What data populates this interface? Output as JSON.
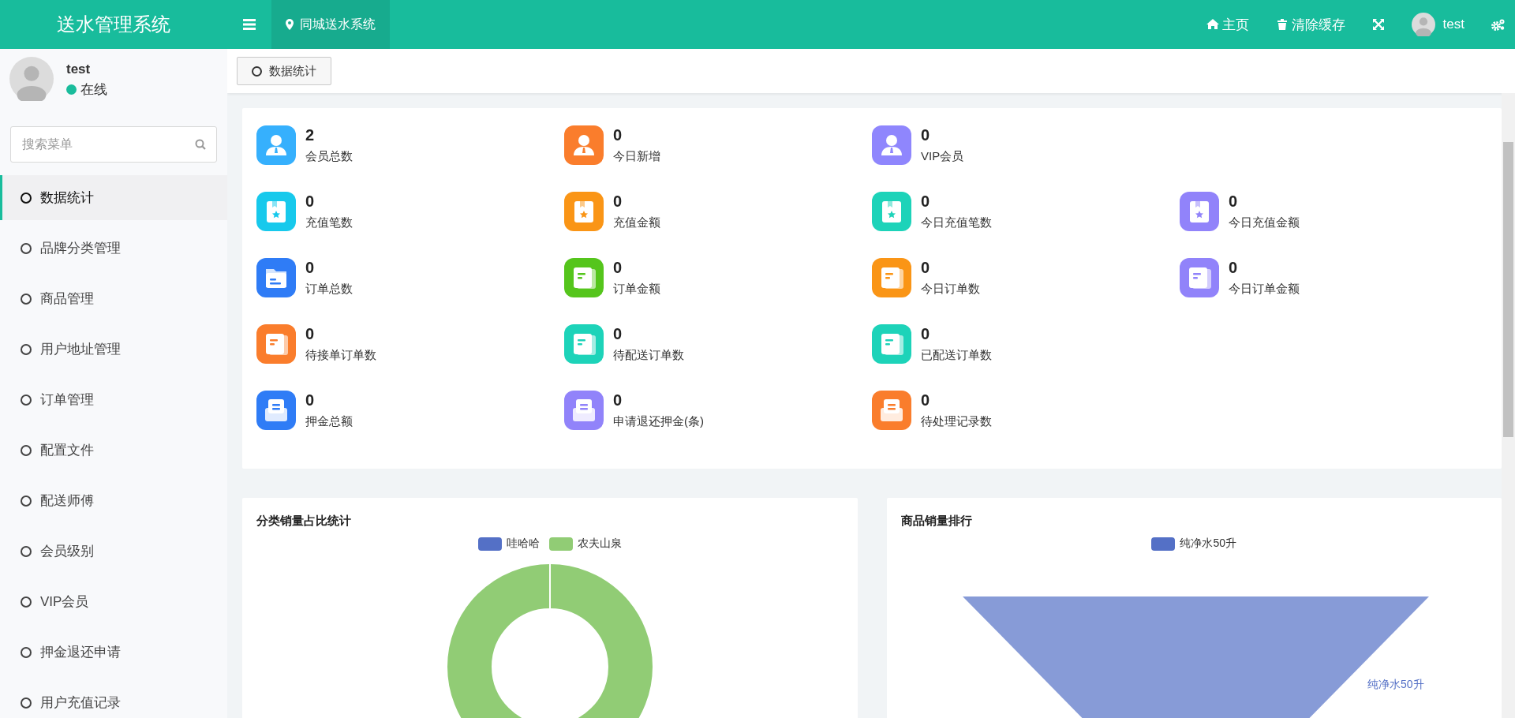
{
  "header": {
    "logo": "送水管理系统",
    "location_tab": "同城送水系统",
    "links": [
      {
        "kind": "home",
        "label": "主页"
      },
      {
        "kind": "trash",
        "label": "清除缓存"
      }
    ],
    "user": "test"
  },
  "sidebar": {
    "user": {
      "name": "test",
      "status": "在线",
      "online": true
    },
    "search": {
      "placeholder": "搜索菜单"
    },
    "items": [
      {
        "label": "数据统计",
        "selected": true
      },
      {
        "label": "品牌分类管理",
        "selected": false
      },
      {
        "label": "商品管理",
        "selected": false
      },
      {
        "label": "用户地址管理",
        "selected": false
      },
      {
        "label": "订单管理",
        "selected": false
      },
      {
        "label": "配置文件",
        "selected": false
      },
      {
        "label": "配送师傅",
        "selected": false
      },
      {
        "label": "会员级别",
        "selected": false
      },
      {
        "label": "VIP会员",
        "selected": false
      },
      {
        "label": "押金退还申请",
        "selected": false
      },
      {
        "label": "用户充值记录",
        "selected": false
      }
    ]
  },
  "tabs": [
    {
      "label": "数据统计"
    }
  ],
  "stats": [
    [
      {
        "kind": "user",
        "color": "#36b0fd",
        "value": "2",
        "label": "会员总数"
      },
      {
        "kind": "user",
        "color": "#fa7d2c",
        "value": "0",
        "label": "今日新增"
      },
      {
        "kind": "user",
        "color": "#8f86fd",
        "value": "0",
        "label": "VIP会员"
      }
    ],
    [
      {
        "kind": "card",
        "color": "#17c9ec",
        "value": "0",
        "label": "充值笔数"
      },
      {
        "kind": "card",
        "color": "#fa9516",
        "value": "0",
        "label": "充值金额"
      },
      {
        "kind": "card",
        "color": "#1dd3b9",
        "value": "0",
        "label": "今日充值笔数"
      },
      {
        "kind": "card",
        "color": "#9183fa",
        "value": "0",
        "label": "今日充值金额"
      }
    ],
    [
      {
        "kind": "folder",
        "color": "#2f7cf6",
        "value": "0",
        "label": "订单总数"
      },
      {
        "kind": "doc",
        "color": "#55c51c",
        "value": "0",
        "label": "订单金额"
      },
      {
        "kind": "doc",
        "color": "#fa9516",
        "value": "0",
        "label": "今日订单数"
      },
      {
        "kind": "doc",
        "color": "#9183fa",
        "value": "0",
        "label": "今日订单金额"
      }
    ],
    [
      {
        "kind": "doc",
        "color": "#fa7d2c",
        "value": "0",
        "label": "待接单订单数"
      },
      {
        "kind": "doc",
        "color": "#1dd3b9",
        "value": "0",
        "label": "待配送订单数"
      },
      {
        "kind": "doc",
        "color": "#1dd3b9",
        "value": "0",
        "label": "已配送订单数"
      }
    ],
    [
      {
        "kind": "tray",
        "color": "#2f7cf6",
        "value": "0",
        "label": "押金总额"
      },
      {
        "kind": "tray",
        "color": "#9183fa",
        "value": "0",
        "label": "申请退还押金(条)"
      },
      {
        "kind": "tray",
        "color": "#fa7d2c",
        "value": "0",
        "label": "待处理记录数"
      }
    ]
  ],
  "charts": [
    {
      "kind": "donut",
      "title": "分类销量占比统计",
      "legend": [
        {
          "label": "哇哈哈",
          "color": "#5470c6"
        },
        {
          "label": "农夫山泉",
          "color": "#91cc75"
        }
      ]
    },
    {
      "kind": "funnel",
      "title": "商品销量排行",
      "legend": [
        {
          "label": "纯净水50升",
          "color": "#5470c6"
        }
      ],
      "slice_label": "纯净水50升"
    }
  ]
}
